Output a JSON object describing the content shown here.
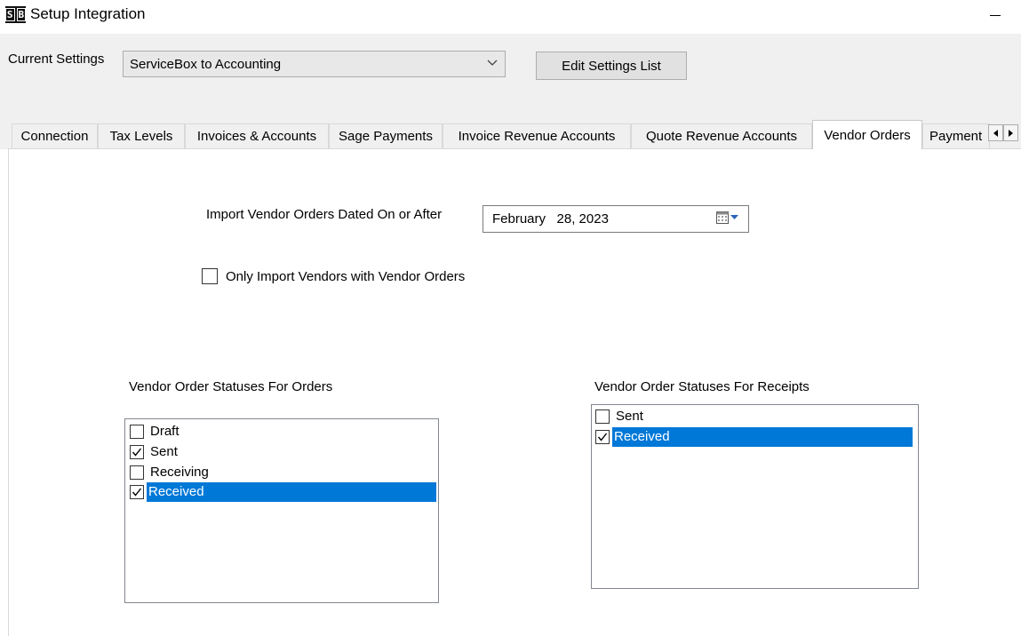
{
  "window": {
    "logo_text": "S|B",
    "logo_left": "S",
    "logo_right": "B",
    "title": "Setup Integration"
  },
  "current_settings": {
    "label": "Current Settings",
    "value": "ServiceBox to Accounting",
    "edit_button": "Edit Settings List"
  },
  "tabs": [
    {
      "label": "Connection",
      "selected": false
    },
    {
      "label": "Tax Levels",
      "selected": false
    },
    {
      "label": "Invoices & Accounts",
      "selected": false
    },
    {
      "label": "Sage Payments",
      "selected": false
    },
    {
      "label": "Invoice Revenue Accounts",
      "selected": false
    },
    {
      "label": "Quote Revenue Accounts",
      "selected": false
    },
    {
      "label": "Vendor Orders",
      "selected": true
    },
    {
      "label": "Payment",
      "selected": false
    }
  ],
  "vendor_orders": {
    "import_label": "Import Vendor Orders Dated On or After",
    "import_date": "February   28, 2023",
    "only_import_label": "Only Import Vendors with Vendor Orders",
    "only_import_checked": false,
    "orders_title": "Vendor Order Statuses For Orders",
    "orders_statuses": [
      {
        "label": "Draft",
        "checked": false,
        "selected": false
      },
      {
        "label": "Sent",
        "checked": true,
        "selected": false
      },
      {
        "label": "Receiving",
        "checked": false,
        "selected": false
      },
      {
        "label": "Received",
        "checked": true,
        "selected": true
      }
    ],
    "receipts_title": "Vendor Order Statuses For Receipts",
    "receipts_statuses": [
      {
        "label": "Sent",
        "checked": false,
        "selected": false
      },
      {
        "label": "Received",
        "checked": true,
        "selected": true
      }
    ]
  },
  "colors": {
    "selection": "#0078d7",
    "band": "#f0f0f0"
  }
}
